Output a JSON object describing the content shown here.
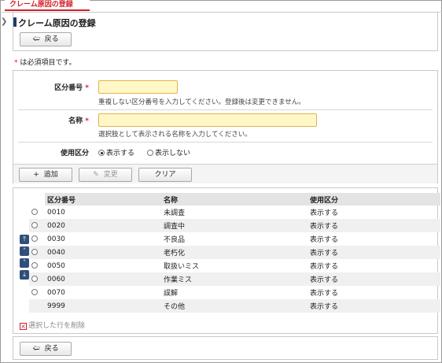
{
  "top_tab": {
    "label": "クレーム原因の登録"
  },
  "header": {
    "title": "クレーム原因の登録",
    "back_label": "戻る"
  },
  "required_note": "は必須項目です。",
  "required_mark": "*",
  "form": {
    "code": {
      "label": "区分番号",
      "required": "*",
      "value": "",
      "help": "重複しない区分番号を入力してください。登録後は変更できません。"
    },
    "name": {
      "label": "名称",
      "required": "*",
      "value": "",
      "help": "選択肢として表示される名称を入力してください。"
    },
    "usage": {
      "label": "使用区分",
      "options": [
        "表示する",
        "表示しない"
      ],
      "selected": "表示する"
    },
    "actions": {
      "add": "追加",
      "change": "変更",
      "clear": "クリア"
    }
  },
  "table": {
    "headers": [
      "区分番号",
      "名称",
      "使用区分"
    ],
    "rows": [
      {
        "code": "0010",
        "name": "未調査",
        "usage": "表示する",
        "selectable": true
      },
      {
        "code": "0020",
        "name": "調査中",
        "usage": "表示する",
        "selectable": true
      },
      {
        "code": "0030",
        "name": "不良品",
        "usage": "表示する",
        "selectable": true
      },
      {
        "code": "0040",
        "name": "老朽化",
        "usage": "表示する",
        "selectable": true
      },
      {
        "code": "0050",
        "name": "取扱いミス",
        "usage": "表示する",
        "selectable": true
      },
      {
        "code": "0060",
        "name": "作業ミス",
        "usage": "表示する",
        "selectable": true
      },
      {
        "code": "0070",
        "name": "誤解",
        "usage": "表示する",
        "selectable": true
      },
      {
        "code": "9999",
        "name": "その他",
        "usage": "表示する",
        "selectable": false
      }
    ],
    "delete_label": "選択した行を削除"
  },
  "footer": {
    "back_label": "戻る"
  },
  "colors": {
    "accent": "#d21f2a",
    "title_bar": "#203a6a",
    "input_bg": "#fff8c6",
    "input_border": "#e2b24e",
    "nav": "#2f4f7a"
  }
}
